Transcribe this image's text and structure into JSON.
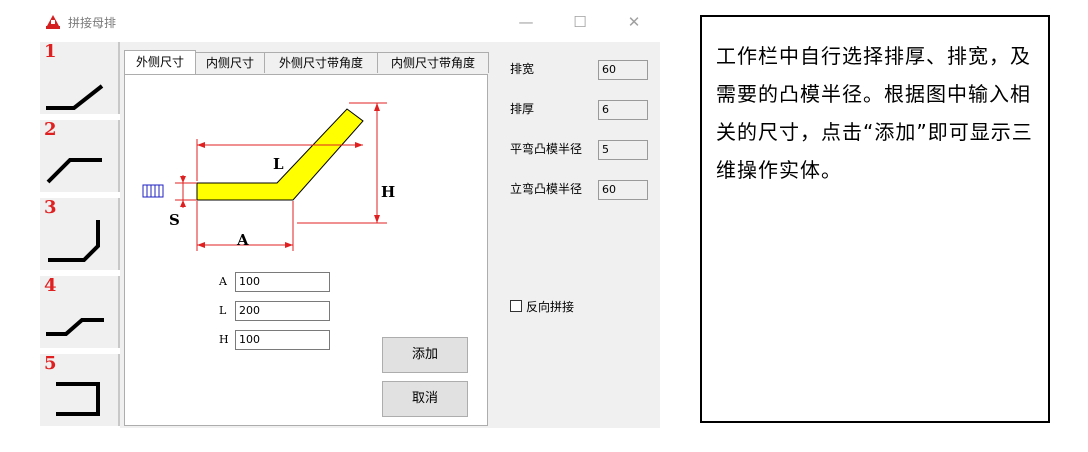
{
  "window": {
    "title": "拼接母排",
    "minimize_glyph": "—",
    "maximize_glyph": "☐",
    "close_glyph": "✕"
  },
  "sidebar": {
    "items": [
      {
        "number": "1",
        "icon": "bend-shape-1-icon"
      },
      {
        "number": "2",
        "icon": "bend-shape-2-icon"
      },
      {
        "number": "3",
        "icon": "bend-shape-3-icon"
      },
      {
        "number": "4",
        "icon": "bend-shape-4-icon"
      },
      {
        "number": "5",
        "icon": "bend-shape-5-icon"
      }
    ]
  },
  "tabs": [
    {
      "label": "外侧尺寸",
      "active": true
    },
    {
      "label": "内侧尺寸",
      "active": false
    },
    {
      "label": "外侧尺寸带角度",
      "active": false
    },
    {
      "label": "内侧尺寸带角度",
      "active": false
    }
  ],
  "diagram": {
    "label_L": "L",
    "label_H": "H",
    "label_A": "A",
    "label_S": "S",
    "fill_color": "#ffff00"
  },
  "inputs": [
    {
      "label": "A",
      "value": "100"
    },
    {
      "label": "L",
      "value": "200"
    },
    {
      "label": "H",
      "value": "100"
    }
  ],
  "buttons": {
    "add": "添加",
    "cancel": "取消"
  },
  "params": [
    {
      "label": "排宽",
      "value": "60"
    },
    {
      "label": "排厚",
      "value": "6"
    },
    {
      "label": "平弯凸模半径",
      "value": "5"
    },
    {
      "label": "立弯凸模半径",
      "value": "60"
    }
  ],
  "reverse_checkbox": {
    "label": "反向拼接",
    "checked": false
  },
  "note": {
    "text": "工作栏中自行选择排厚、排宽，及需要的凸模半径。根据图中输入相关的尺寸，点击“添加”即可显示三维操作实体。"
  }
}
